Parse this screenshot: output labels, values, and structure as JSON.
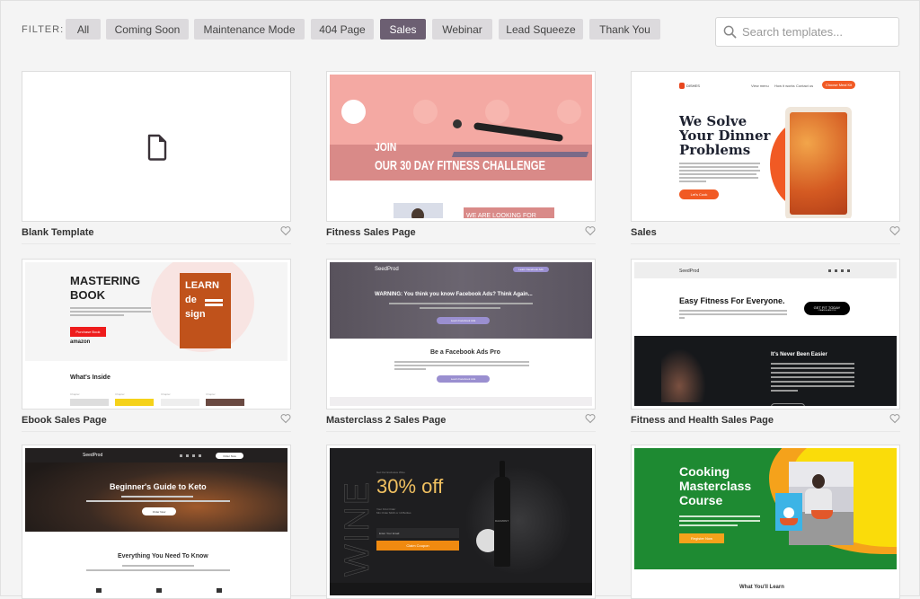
{
  "filter": {
    "label": "FILTER:",
    "buttons": [
      {
        "label": "All",
        "active": false
      },
      {
        "label": "Coming Soon",
        "active": false
      },
      {
        "label": "Maintenance Mode",
        "active": false
      },
      {
        "label": "404 Page",
        "active": false
      },
      {
        "label": "Sales",
        "active": true
      },
      {
        "label": "Webinar",
        "active": false
      },
      {
        "label": "Lead Squeeze",
        "active": false
      },
      {
        "label": "Thank You",
        "active": false
      }
    ]
  },
  "search": {
    "placeholder": "Search templates...",
    "value": "",
    "icon": "search-icon"
  },
  "colors": {
    "active_filter": "#6c5f72",
    "filter_bg": "#dcdadd",
    "page_bg": "#f4f4f4"
  },
  "templates": [
    {
      "title": "Blank Template",
      "icon": "file-icon"
    },
    {
      "title": "Fitness Sales Page",
      "preview": {
        "line1": "JOIN",
        "line2": "OUR 30 DAY FITNESS CHALLENGE",
        "sub": "WE ARE LOOKING FOR"
      }
    },
    {
      "title": "Sales",
      "preview": {
        "brand": "DISHES",
        "nav": [
          "View menu",
          "How it works",
          "Contact us"
        ],
        "cta": "Choose Meal Kit",
        "headline1": "We Solve",
        "headline2": "Your Dinner",
        "headline3": "Problems",
        "button": "Let's Cook"
      }
    },
    {
      "title": "Ebook Sales Page",
      "preview": {
        "headline1": "MASTERING",
        "headline2": "BOOK",
        "button": "Purchase Book",
        "store": "amazon",
        "cover1": "LEARN",
        "cover2": "de",
        "cover3": "sign",
        "section": "What's Inside",
        "chapter": "Chapter"
      }
    },
    {
      "title": "Masterclass 2 Sales Page",
      "preview": {
        "brand": "SeedProd",
        "nav_button": "Learn Facebook Ads",
        "headline": "WARNING: You think you know Facebook Ads? Think Again...",
        "button": "Learn Facebook Ads",
        "section": "Be a Facebook Ads Pro"
      }
    },
    {
      "title": "Fitness and Health Sales Page",
      "preview": {
        "brand": "SeedProd",
        "headline": "Easy Fitness For Everyone.",
        "cta": "GET FIT TODAY",
        "cta_sub": "CREATE A NEW YOU",
        "section": "It's Never Been Easier",
        "button": "GET FIT TODAY"
      }
    },
    {
      "title": "",
      "preview": {
        "brand": "SeedProd",
        "nav_button": "Order Now",
        "headline": "Beginner's Guide to Keto",
        "button": "Order Now",
        "section": "Everything You Need To Know"
      }
    },
    {
      "title": "",
      "preview": {
        "side_word": "WINE",
        "kicker": "Get Our Exclusive Wine",
        "headline": "30% off",
        "sub1": "Your First Order",
        "sub2": "Min Order $100 or 10 Bottles",
        "input_placeholder": "Enter Your Email",
        "button": "Claim Coupon",
        "bottle_label": "DAUMONT"
      }
    },
    {
      "title": "",
      "preview": {
        "headline1": "Cooking",
        "headline2": "Masterclass",
        "headline3": "Course",
        "button": "Register Now",
        "section": "What You'll Learn"
      }
    }
  ]
}
